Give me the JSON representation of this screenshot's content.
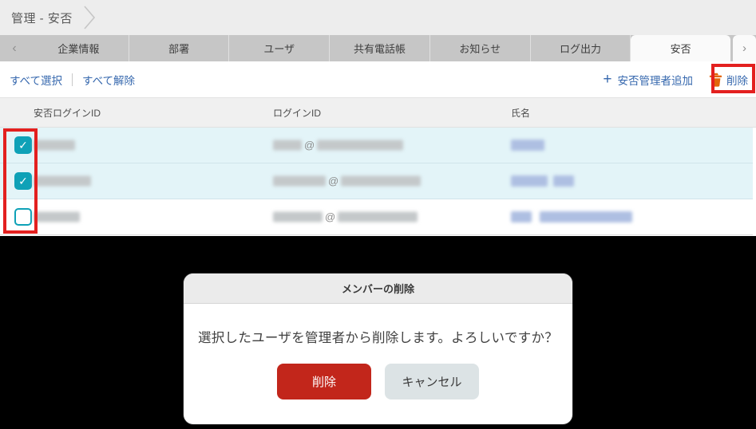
{
  "colors": {
    "accent_blue": "#3668ae",
    "checkbox_teal": "#0ea1b7",
    "trash_orange": "#e2660b",
    "annotation_red": "#e3201f",
    "confirm_red": "#c2261b",
    "row_highlight": "#e3f4f8"
  },
  "breadcrumb": {
    "title": "管理 - 安否"
  },
  "tabs": {
    "prev_arrow": "‹",
    "next_arrow": "›",
    "selected": "安否",
    "items": [
      {
        "label": "企業情報"
      },
      {
        "label": "部署"
      },
      {
        "label": "ユーザ"
      },
      {
        "label": "共有電話帳"
      },
      {
        "label": "お知らせ"
      },
      {
        "label": "ログ出力"
      },
      {
        "label": "安否"
      }
    ]
  },
  "toolbar": {
    "select_all_label": "すべて選択",
    "deselect_all_label": "すべて解除",
    "add_icon": "+",
    "add_admin_label": "安否管理者追加",
    "delete_label": "削除"
  },
  "table": {
    "columns": [
      "安否ログインID",
      "ログインID",
      "氏名"
    ],
    "at_symbol": "@",
    "checkmark": "✓",
    "rows": [
      {
        "checked": true,
        "redacted": true
      },
      {
        "checked": true,
        "redacted": true
      },
      {
        "checked": false,
        "redacted": true
      }
    ]
  },
  "dialog": {
    "title": "メンバーの削除",
    "message": "選択したユーザを管理者から削除します。よろしいですか？",
    "confirm_label": "削除",
    "cancel_label": "キャンセル"
  }
}
